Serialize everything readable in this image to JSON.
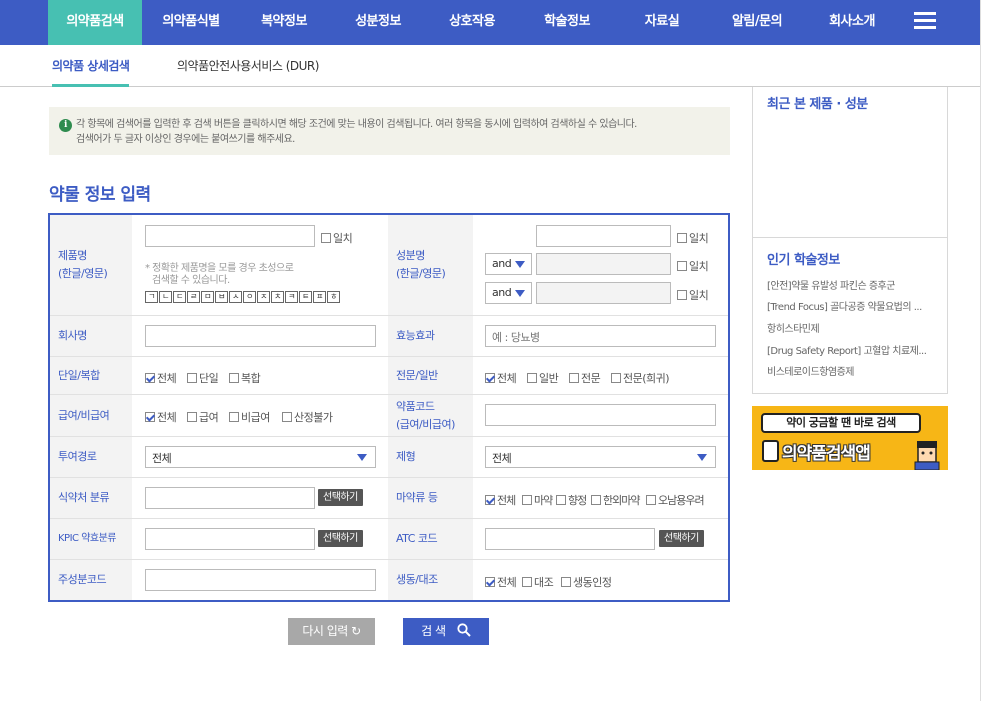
{
  "nav": {
    "items": [
      "의약품검색",
      "의약품식별",
      "복약정보",
      "성분정보",
      "상호작용",
      "학술정보",
      "자료실",
      "알림/문의",
      "회사소개"
    ],
    "active_index": 0
  },
  "subnav": {
    "items": [
      "의약품 상세검색",
      "의약품안전사용서비스 (DUR)"
    ],
    "active_index": 0
  },
  "info": {
    "line1": "각 항목에 검색어를 입력한 후 검색 버튼을 클릭하시면 해당 조건에 맞는 내용이 검색됩니다. 여러 항목을 동시에 입력하여 검색하실 수 있습니다.",
    "line2": "검색어가 두 글자 이상인 경우에는 붙여쓰기를 해주세요."
  },
  "form": {
    "title": "약물 정보 입력",
    "product_name": {
      "label_line1": "제품명",
      "label_line2": "(한글/영문)",
      "exact": "일치",
      "hint_line1": "* 정확한 제품명을 모를 경우 초성으로",
      "hint_line2": "검색할 수 있습니다.",
      "consonants": [
        "ㄱ",
        "ㄴ",
        "ㄷ",
        "ㄹ",
        "ㅁ",
        "ㅂ",
        "ㅅ",
        "ㅇ",
        "ㅈ",
        "ㅊ",
        "ㅋ",
        "ㅌ",
        "ㅍ",
        "ㅎ"
      ]
    },
    "ingredient": {
      "label_line1": "성분명",
      "label_line2": "(한글/영문)",
      "exact": "일치",
      "op1": "and",
      "op2": "and"
    },
    "company": {
      "label": "회사명"
    },
    "efficacy": {
      "label": "효능효과",
      "placeholder": "예 : 당뇨병"
    },
    "single_combo": {
      "label": "단일/복합",
      "options": [
        "전체",
        "단일",
        "복합"
      ],
      "checked": [
        true,
        false,
        false
      ]
    },
    "prescription": {
      "label": "전문/일반",
      "options": [
        "전체",
        "일반",
        "전문",
        "전문(희귀)"
      ],
      "checked": [
        true,
        false,
        false,
        false
      ]
    },
    "coverage": {
      "label": "급여/비급여",
      "options": [
        "전체",
        "급여",
        "비급여",
        "산정불가"
      ],
      "checked": [
        true,
        false,
        false,
        false
      ]
    },
    "drug_code": {
      "label_line1": "약품코드",
      "label_line2": "(급여/비급여)"
    },
    "route": {
      "label": "투여경로",
      "selected": "전체"
    },
    "dosage_form": {
      "label": "제형",
      "selected": "전체"
    },
    "mfds_class": {
      "label": "식약처 분류",
      "button": "선택하기"
    },
    "narcotic": {
      "label": "마약류 등",
      "options": [
        "전체",
        "마약",
        "향정",
        "한외마약",
        "오남용우려"
      ],
      "checked": [
        true,
        false,
        false,
        false,
        false
      ]
    },
    "kpic_class": {
      "label": "KPIC 약효분류",
      "button": "선택하기"
    },
    "atc": {
      "label": "ATC 코드",
      "button": "선택하기"
    },
    "ingredient_code": {
      "label": "주성분코드"
    },
    "bioequiv": {
      "label": "생동/대조",
      "options": [
        "전체",
        "대조",
        "생동인정"
      ],
      "checked": [
        true,
        false,
        false
      ]
    }
  },
  "buttons": {
    "reset": "다시 입력 ↻",
    "search": "검 색"
  },
  "sidebar": {
    "recent_title": "최근 본 제품 · 성분",
    "popular_title": "인기 학술정보",
    "popular_items": [
      "[안전]약물 유발성 파킨슨 증후군",
      "[Trend Focus] 골다공증 약물요법의 ...",
      "항히스타민제",
      "[Drug Safety Report] 고혈압 치료제...",
      "비스테로이드항염증제"
    ]
  },
  "banner": {
    "bubble": "약이 궁금할 땐 바로 검색",
    "app_text": "의약품검색앱"
  }
}
